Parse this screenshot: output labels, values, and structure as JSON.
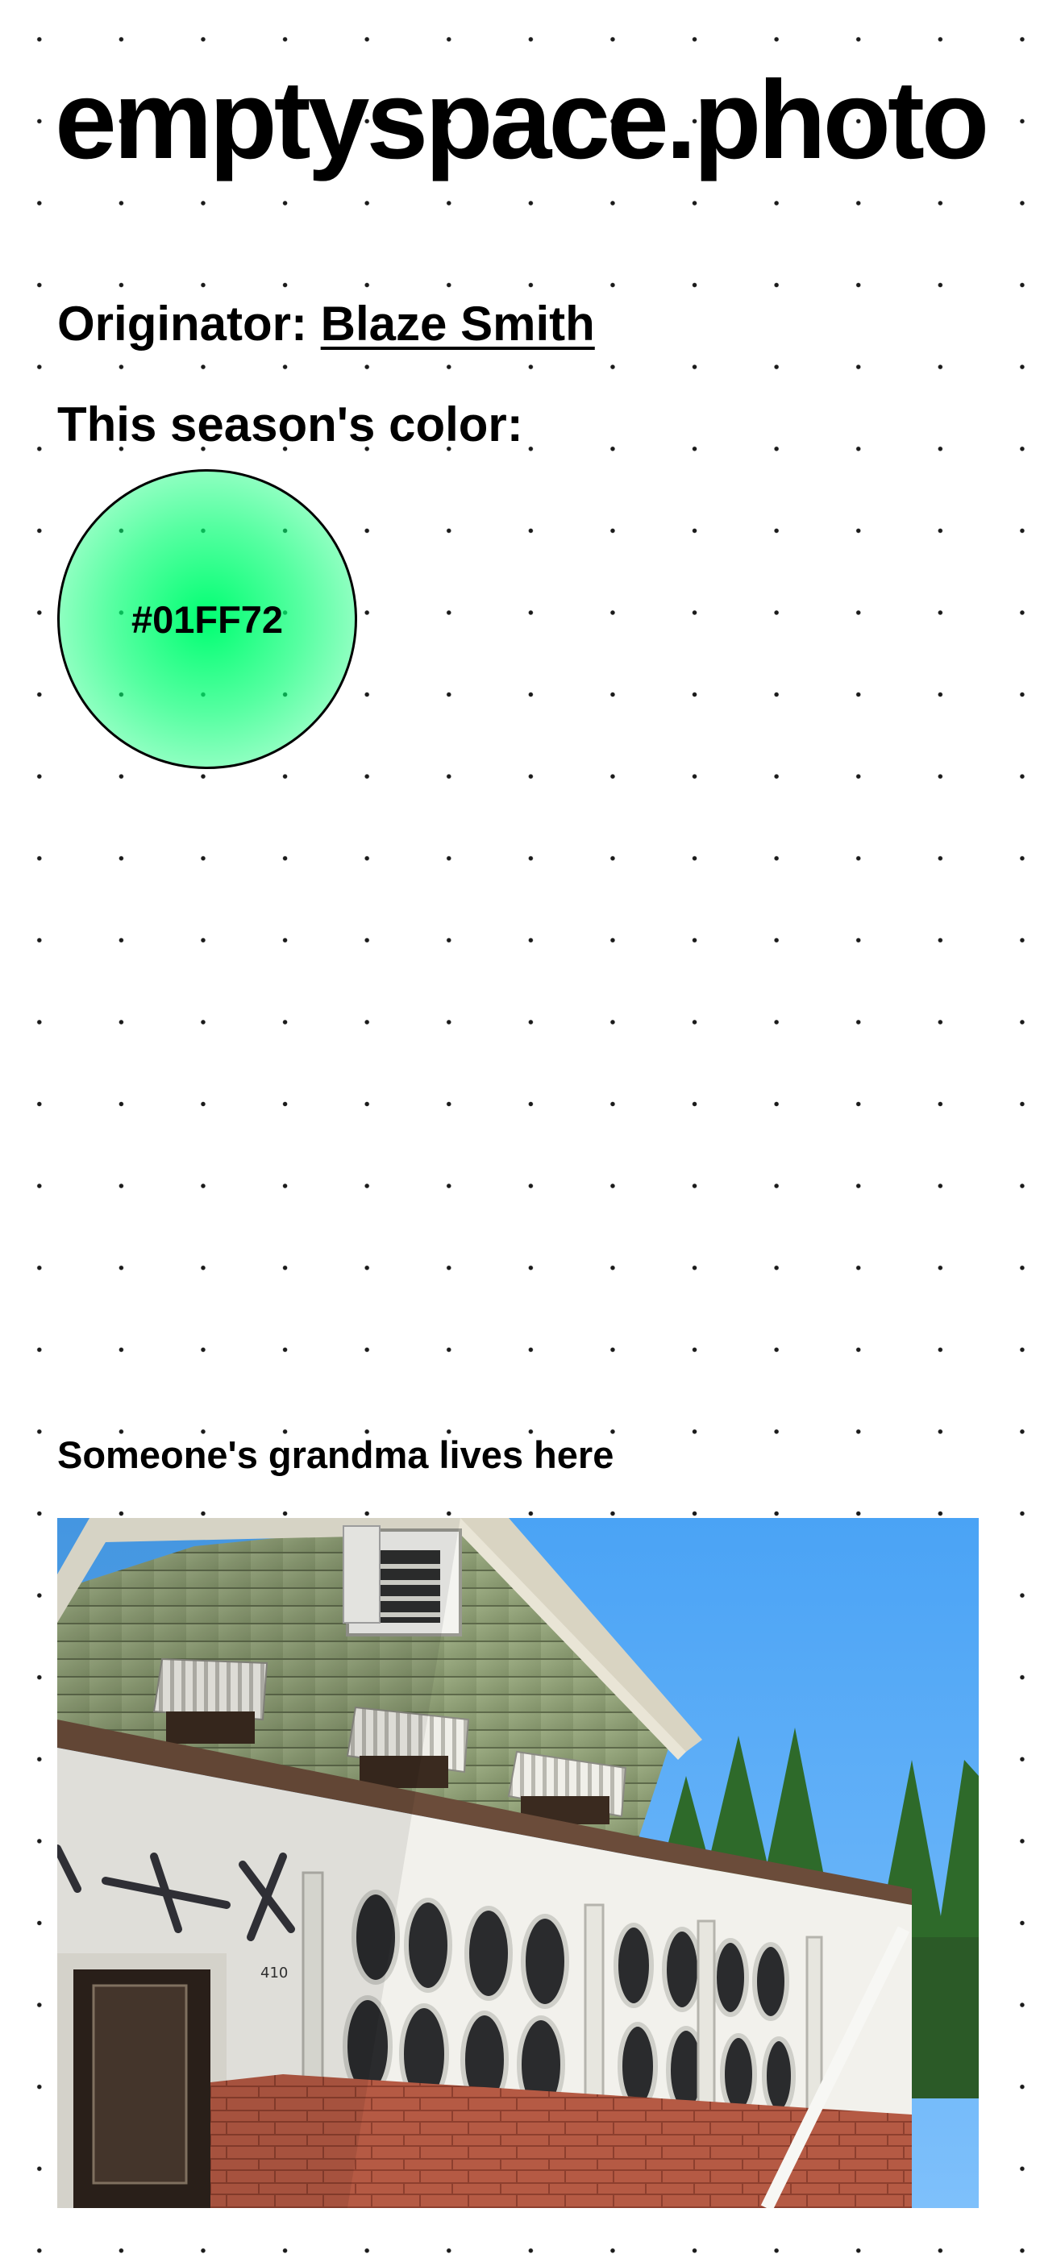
{
  "site": {
    "title": "emptyspace.photo"
  },
  "originator": {
    "label": "Originator:",
    "name": "Blaze Smith"
  },
  "season": {
    "label": "This season's color:",
    "color_hex_label": "#01FF72",
    "color": "#01FF72"
  },
  "post": {
    "title": "Someone's grandma lives here",
    "house_number": "410"
  },
  "colors": {
    "background": "#ffffff",
    "dots": "#1a1a1a",
    "text": "#000000",
    "season_color": "#01FF72"
  }
}
